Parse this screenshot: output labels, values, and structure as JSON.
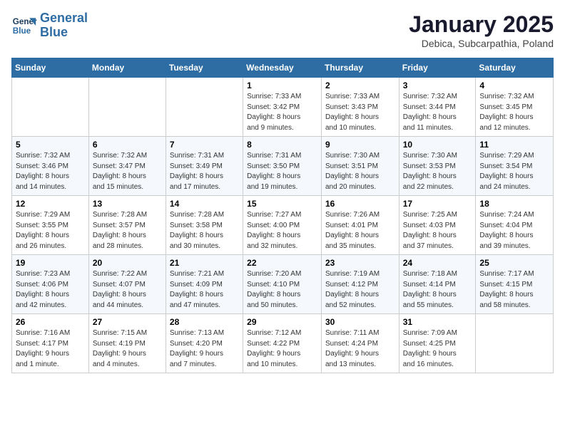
{
  "logo": {
    "line1": "General",
    "line2": "Blue"
  },
  "title": "January 2025",
  "subtitle": "Debica, Subcarpathia, Poland",
  "days_of_week": [
    "Sunday",
    "Monday",
    "Tuesday",
    "Wednesday",
    "Thursday",
    "Friday",
    "Saturday"
  ],
  "weeks": [
    [
      {
        "day": "",
        "info": ""
      },
      {
        "day": "",
        "info": ""
      },
      {
        "day": "",
        "info": ""
      },
      {
        "day": "1",
        "info": "Sunrise: 7:33 AM\nSunset: 3:42 PM\nDaylight: 8 hours\nand 9 minutes."
      },
      {
        "day": "2",
        "info": "Sunrise: 7:33 AM\nSunset: 3:43 PM\nDaylight: 8 hours\nand 10 minutes."
      },
      {
        "day": "3",
        "info": "Sunrise: 7:32 AM\nSunset: 3:44 PM\nDaylight: 8 hours\nand 11 minutes."
      },
      {
        "day": "4",
        "info": "Sunrise: 7:32 AM\nSunset: 3:45 PM\nDaylight: 8 hours\nand 12 minutes."
      }
    ],
    [
      {
        "day": "5",
        "info": "Sunrise: 7:32 AM\nSunset: 3:46 PM\nDaylight: 8 hours\nand 14 minutes."
      },
      {
        "day": "6",
        "info": "Sunrise: 7:32 AM\nSunset: 3:47 PM\nDaylight: 8 hours\nand 15 minutes."
      },
      {
        "day": "7",
        "info": "Sunrise: 7:31 AM\nSunset: 3:49 PM\nDaylight: 8 hours\nand 17 minutes."
      },
      {
        "day": "8",
        "info": "Sunrise: 7:31 AM\nSunset: 3:50 PM\nDaylight: 8 hours\nand 19 minutes."
      },
      {
        "day": "9",
        "info": "Sunrise: 7:30 AM\nSunset: 3:51 PM\nDaylight: 8 hours\nand 20 minutes."
      },
      {
        "day": "10",
        "info": "Sunrise: 7:30 AM\nSunset: 3:53 PM\nDaylight: 8 hours\nand 22 minutes."
      },
      {
        "day": "11",
        "info": "Sunrise: 7:29 AM\nSunset: 3:54 PM\nDaylight: 8 hours\nand 24 minutes."
      }
    ],
    [
      {
        "day": "12",
        "info": "Sunrise: 7:29 AM\nSunset: 3:55 PM\nDaylight: 8 hours\nand 26 minutes."
      },
      {
        "day": "13",
        "info": "Sunrise: 7:28 AM\nSunset: 3:57 PM\nDaylight: 8 hours\nand 28 minutes."
      },
      {
        "day": "14",
        "info": "Sunrise: 7:28 AM\nSunset: 3:58 PM\nDaylight: 8 hours\nand 30 minutes."
      },
      {
        "day": "15",
        "info": "Sunrise: 7:27 AM\nSunset: 4:00 PM\nDaylight: 8 hours\nand 32 minutes."
      },
      {
        "day": "16",
        "info": "Sunrise: 7:26 AM\nSunset: 4:01 PM\nDaylight: 8 hours\nand 35 minutes."
      },
      {
        "day": "17",
        "info": "Sunrise: 7:25 AM\nSunset: 4:03 PM\nDaylight: 8 hours\nand 37 minutes."
      },
      {
        "day": "18",
        "info": "Sunrise: 7:24 AM\nSunset: 4:04 PM\nDaylight: 8 hours\nand 39 minutes."
      }
    ],
    [
      {
        "day": "19",
        "info": "Sunrise: 7:23 AM\nSunset: 4:06 PM\nDaylight: 8 hours\nand 42 minutes."
      },
      {
        "day": "20",
        "info": "Sunrise: 7:22 AM\nSunset: 4:07 PM\nDaylight: 8 hours\nand 44 minutes."
      },
      {
        "day": "21",
        "info": "Sunrise: 7:21 AM\nSunset: 4:09 PM\nDaylight: 8 hours\nand 47 minutes."
      },
      {
        "day": "22",
        "info": "Sunrise: 7:20 AM\nSunset: 4:10 PM\nDaylight: 8 hours\nand 50 minutes."
      },
      {
        "day": "23",
        "info": "Sunrise: 7:19 AM\nSunset: 4:12 PM\nDaylight: 8 hours\nand 52 minutes."
      },
      {
        "day": "24",
        "info": "Sunrise: 7:18 AM\nSunset: 4:14 PM\nDaylight: 8 hours\nand 55 minutes."
      },
      {
        "day": "25",
        "info": "Sunrise: 7:17 AM\nSunset: 4:15 PM\nDaylight: 8 hours\nand 58 minutes."
      }
    ],
    [
      {
        "day": "26",
        "info": "Sunrise: 7:16 AM\nSunset: 4:17 PM\nDaylight: 9 hours\nand 1 minute."
      },
      {
        "day": "27",
        "info": "Sunrise: 7:15 AM\nSunset: 4:19 PM\nDaylight: 9 hours\nand 4 minutes."
      },
      {
        "day": "28",
        "info": "Sunrise: 7:13 AM\nSunset: 4:20 PM\nDaylight: 9 hours\nand 7 minutes."
      },
      {
        "day": "29",
        "info": "Sunrise: 7:12 AM\nSunset: 4:22 PM\nDaylight: 9 hours\nand 10 minutes."
      },
      {
        "day": "30",
        "info": "Sunrise: 7:11 AM\nSunset: 4:24 PM\nDaylight: 9 hours\nand 13 minutes."
      },
      {
        "day": "31",
        "info": "Sunrise: 7:09 AM\nSunset: 4:25 PM\nDaylight: 9 hours\nand 16 minutes."
      },
      {
        "day": "",
        "info": ""
      }
    ]
  ]
}
